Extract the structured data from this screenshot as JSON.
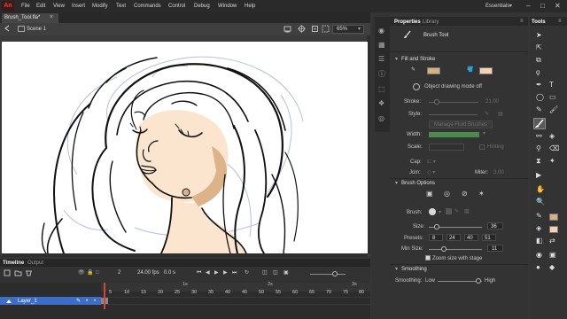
{
  "app": {
    "logo": "An",
    "menu": [
      "File",
      "Edit",
      "View",
      "Insert",
      "Modify",
      "Text",
      "Commands",
      "Control",
      "Debug",
      "Window",
      "Help"
    ],
    "workspace": "Essentials",
    "window_controls": [
      "–",
      "□",
      "✕"
    ]
  },
  "document": {
    "tab_label": "Brush_Tool.fla*",
    "close_glyph": "×",
    "scene_label": "Scene 1",
    "zoom": "65%"
  },
  "timeline": {
    "tabs": [
      "Timeline",
      "Output"
    ],
    "current_frame": "2",
    "fps": "24.00 fps",
    "time": "0.0 s",
    "seconds_markers": [
      "1s",
      "2s",
      "3s"
    ],
    "frame_ticks": [
      "5",
      "10",
      "15",
      "20",
      "25",
      "30",
      "35",
      "40",
      "45",
      "50",
      "55",
      "60",
      "65",
      "70",
      "75",
      "80"
    ],
    "layer_name": "Layer_1"
  },
  "properties": {
    "tabs": [
      "Properties",
      "Library"
    ],
    "tool_name": "Brush Tool",
    "fill_stroke": {
      "title": "Fill and Stroke",
      "stroke_color": "#d9b07e",
      "fill_color": "#f3d3b3",
      "object_drawing": "Object drawing mode off",
      "stroke_label": "Stroke:",
      "stroke_value": "21.00",
      "style_label": "Style:",
      "manage_brushes": "Manage Fluid Brushes",
      "width_label": "Width:",
      "scale_label": "Scale:",
      "hinting_label": "Hinting",
      "cap_label": "Cap:",
      "join_label": "Join:",
      "miter_label": "Miter:",
      "miter_value": "3.00"
    },
    "brush_options": {
      "title": "Brush Options",
      "brush_label": "Brush:",
      "size_label": "Size:",
      "size_value": "36",
      "presets_label": "Presets:",
      "presets": [
        "8",
        "24",
        "40",
        "51"
      ],
      "min_size_label": "Min Size:",
      "min_size_value": "11",
      "zoom_checkbox": "Zoom size with stage"
    },
    "smoothing": {
      "title": "Smoothing",
      "label": "Smoothing:",
      "low": "Low",
      "high": "High"
    }
  },
  "tools": {
    "title": "Tools"
  },
  "colors": {
    "skin": "#fbe5cf",
    "shadow": "#ddb489",
    "accent": "#3c6ec9",
    "guide": "#b8bde6"
  }
}
